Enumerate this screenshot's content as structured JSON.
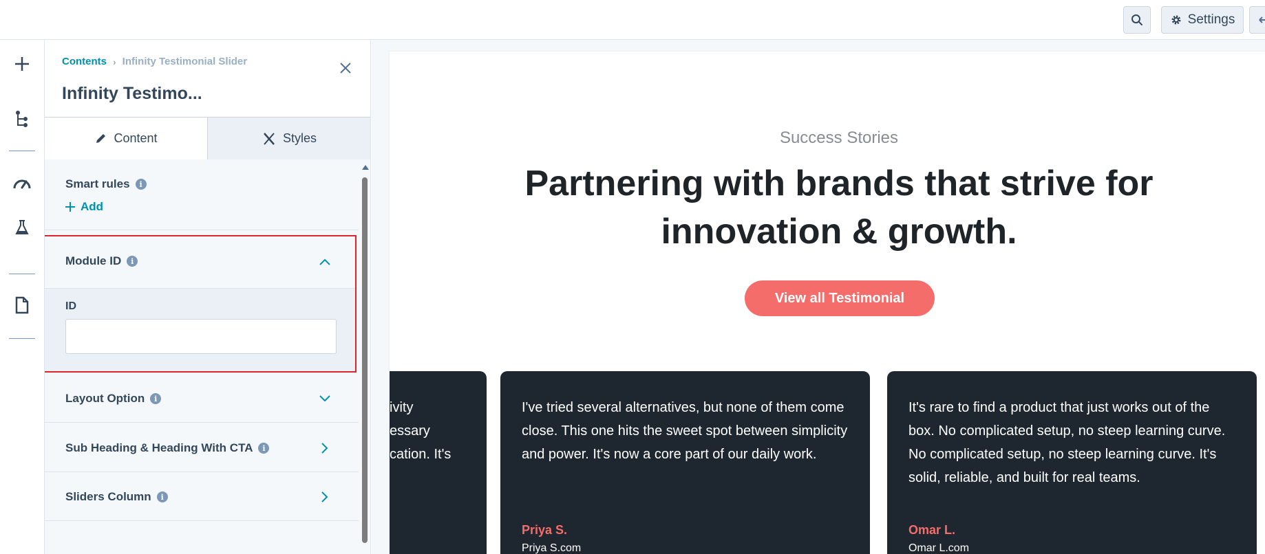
{
  "topbar": {
    "settings_label": "Settings",
    "search_icon": "search-icon",
    "settings_icon": "gear-icon"
  },
  "rail": {
    "items": [
      "add-icon",
      "tree-icon",
      "speedometer-icon",
      "flask-icon",
      "document-icon"
    ]
  },
  "panel": {
    "breadcrumb": {
      "parent": "Contents",
      "current": "Infinity Testimonial Slider"
    },
    "title": "Infinity Testimo...",
    "tabs": [
      {
        "label": "Content",
        "icon": "pencil-icon"
      },
      {
        "label": "Styles",
        "icon": "brush-icon"
      }
    ],
    "smart_rules": {
      "label": "Smart rules",
      "add_label": "Add"
    },
    "module_id": {
      "label": "Module ID",
      "field_label": "ID",
      "value": ""
    },
    "sections": [
      {
        "label": "Layout Option",
        "chevron": "down"
      },
      {
        "label": "Sub Heading & Heading With CTA",
        "chevron": "right"
      },
      {
        "label": "Sliders Column",
        "chevron": "right"
      }
    ]
  },
  "preview": {
    "subheading": "Success Stories",
    "heading": "Partnering with brands that strive for innovation & growth.",
    "cta_label": "View all Testimonial",
    "accent_color": "#f46d6a",
    "cards": [
      {
        "quote": "ivity\nessary\ncation. It's",
        "name": "",
        "site": ""
      },
      {
        "quote": "I've tried several alternatives, but none of them come close. This one hits the sweet spot between simplicity and power. It's now a core part of our daily work.",
        "name": "Priya S.",
        "site": "Priya S.com"
      },
      {
        "quote": "It's rare to find a product that just works out of the box. No complicated setup, no steep learning curve. No complicated setup, no steep learning curve. It's solid, reliable, and built for real teams.",
        "name": "Omar L.",
        "site": "Omar L.com"
      }
    ]
  }
}
